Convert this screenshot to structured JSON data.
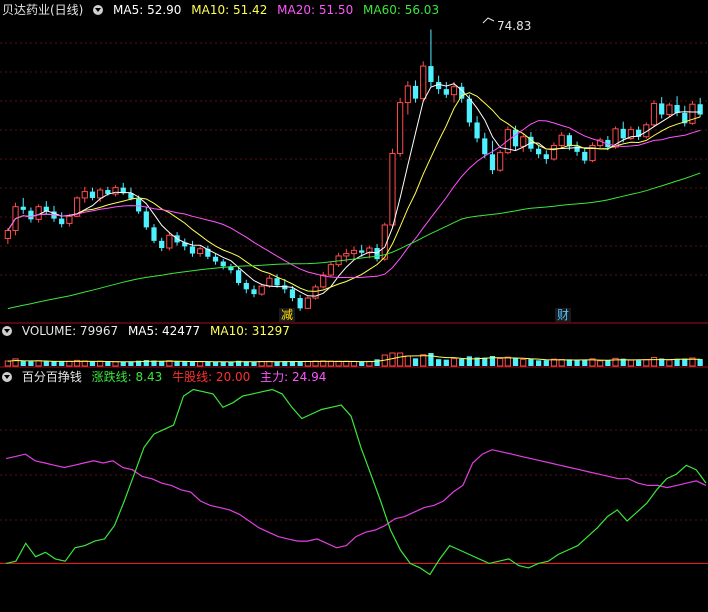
{
  "colors": {
    "bg": "#000000",
    "grid": "#5a0f0f",
    "divider": "#a0101a",
    "up": "#ff4d4d",
    "down": "#4ff0ff",
    "ma5": "#ffffff",
    "ma10": "#ffff55",
    "ma20": "#ff55ff",
    "ma60": "#3ce63c",
    "green_line": "#3ce63c",
    "pink_line": "#e040e0",
    "red_level": "#ff2020"
  },
  "main": {
    "title": "贝达药业(日线)",
    "ma_labels": [
      {
        "text": "MA5: 52.90",
        "color": "#ffffff"
      },
      {
        "text": "MA10: 51.42",
        "color": "#ffff55"
      },
      {
        "text": "MA20: 51.50",
        "color": "#ff55ff"
      },
      {
        "text": "MA60: 56.03",
        "color": "#3ce63c"
      }
    ],
    "peak_label": "74.83",
    "event_markers": [
      "减",
      "财"
    ]
  },
  "volume": {
    "title": "VOLUME: 79967",
    "ma_labels": [
      {
        "text": "MA5: 42477",
        "color": "#ffffff"
      },
      {
        "text": "MA10: 31297",
        "color": "#ffff55"
      }
    ]
  },
  "indicator": {
    "title": "百分百挣钱",
    "labels": [
      {
        "text": "涨跌线: 8.43",
        "color": "#3ce63c"
      },
      {
        "text": "牛股线: 20.00",
        "color": "#ff3030"
      },
      {
        "text": "主力: 24.94",
        "color": "#ff55ff"
      }
    ]
  },
  "chart_data": [
    {
      "type": "candlestick",
      "price_range": [
        40,
        76
      ],
      "candles": [
        [
          48.5,
          49.8,
          47.8,
          49.5
        ],
        [
          49.5,
          53.0,
          48.9,
          52.5
        ],
        [
          52.5,
          53.6,
          51.6,
          52.1
        ],
        [
          52.0,
          52.4,
          50.5,
          50.9
        ],
        [
          50.9,
          52.8,
          50.5,
          52.5
        ],
        [
          52.5,
          53.2,
          51.5,
          51.9
        ],
        [
          51.9,
          52.6,
          50.6,
          51.0
        ],
        [
          51.0,
          51.8,
          49.9,
          50.3
        ],
        [
          50.4,
          51.6,
          50.0,
          51.3
        ],
        [
          51.3,
          53.8,
          51.2,
          53.6
        ],
        [
          53.6,
          55.0,
          53.0,
          54.4
        ],
        [
          54.4,
          54.9,
          53.3,
          53.6
        ],
        [
          53.6,
          54.9,
          53.1,
          54.6
        ],
        [
          54.6,
          55.0,
          53.9,
          54.1
        ],
        [
          54.1,
          55.2,
          53.8,
          54.9
        ],
        [
          54.9,
          55.5,
          54.0,
          54.2
        ],
        [
          54.2,
          54.9,
          53.3,
          53.5
        ],
        [
          53.5,
          53.9,
          51.6,
          51.9
        ],
        [
          51.9,
          52.5,
          49.6,
          49.9
        ],
        [
          49.9,
          50.3,
          47.9,
          48.2
        ],
        [
          48.2,
          48.6,
          46.9,
          47.3
        ],
        [
          47.3,
          49.3,
          47.0,
          48.9
        ],
        [
          48.9,
          49.3,
          47.6,
          48.0
        ],
        [
          48.0,
          48.5,
          47.0,
          47.5
        ],
        [
          47.5,
          48.2,
          46.2,
          46.6
        ],
        [
          46.6,
          47.5,
          46.2,
          47.2
        ],
        [
          47.2,
          47.6,
          45.9,
          46.2
        ],
        [
          46.2,
          46.6,
          45.2,
          45.6
        ],
        [
          45.6,
          45.9,
          44.6,
          45.0
        ],
        [
          45.0,
          45.3,
          44.1,
          44.5
        ],
        [
          44.5,
          44.8,
          42.6,
          42.9
        ],
        [
          42.9,
          43.3,
          41.6,
          42.1
        ],
        [
          42.1,
          42.6,
          41.1,
          41.5
        ],
        [
          41.5,
          42.8,
          41.3,
          42.5
        ],
        [
          42.5,
          43.9,
          42.3,
          43.5
        ],
        [
          43.5,
          44.0,
          42.3,
          42.6
        ],
        [
          42.6,
          43.4,
          41.6,
          42.1
        ],
        [
          42.1,
          42.5,
          40.6,
          41.0
        ],
        [
          41.0,
          41.4,
          39.4,
          39.7
        ],
        [
          39.7,
          41.2,
          39.6,
          41.0
        ],
        [
          41.0,
          42.7,
          40.8,
          42.4
        ],
        [
          42.4,
          44.3,
          42.2,
          43.9
        ],
        [
          43.9,
          45.5,
          43.7,
          45.2
        ],
        [
          45.2,
          46.7,
          44.9,
          46.3
        ],
        [
          46.3,
          47.2,
          45.5,
          46.6
        ],
        [
          46.6,
          47.5,
          45.9,
          47.0
        ],
        [
          47.0,
          47.7,
          46.2,
          46.7
        ],
        [
          46.7,
          47.6,
          46.0,
          47.3
        ],
        [
          47.3,
          47.8,
          45.6,
          45.9
        ],
        [
          45.9,
          50.5,
          45.7,
          50.2
        ],
        [
          50.2,
          59.8,
          49.9,
          59.2
        ],
        [
          59.2,
          66.2,
          58.8,
          65.6
        ],
        [
          65.6,
          68.3,
          64.1,
          67.7
        ],
        [
          67.7,
          68.4,
          65.6,
          66.1
        ],
        [
          66.1,
          70.8,
          65.8,
          70.2
        ],
        [
          70.2,
          74.8,
          67.6,
          68.2
        ],
        [
          68.2,
          69.0,
          66.7,
          67.3
        ],
        [
          67.3,
          68.2,
          66.2,
          66.6
        ],
        [
          66.6,
          68.2,
          65.6,
          67.6
        ],
        [
          67.6,
          68.1,
          65.6,
          66.1
        ],
        [
          66.1,
          66.6,
          62.6,
          63.1
        ],
        [
          63.1,
          63.9,
          60.6,
          61.1
        ],
        [
          61.1,
          61.8,
          58.6,
          59.1
        ],
        [
          59.1,
          60.8,
          56.6,
          57.1
        ],
        [
          57.1,
          59.6,
          56.9,
          59.3
        ],
        [
          59.3,
          62.6,
          59.1,
          62.2
        ],
        [
          62.2,
          62.7,
          59.6,
          60.1
        ],
        [
          60.1,
          61.6,
          59.4,
          61.3
        ],
        [
          61.3,
          61.9,
          59.4,
          59.8
        ],
        [
          59.8,
          60.2,
          58.6,
          59.1
        ],
        [
          59.1,
          59.6,
          57.9,
          58.5
        ],
        [
          58.5,
          60.6,
          58.3,
          60.2
        ],
        [
          60.2,
          61.9,
          59.8,
          61.5
        ],
        [
          61.5,
          61.8,
          59.6,
          60.1
        ],
        [
          60.1,
          60.7,
          58.9,
          59.4
        ],
        [
          59.4,
          59.8,
          57.9,
          58.3
        ],
        [
          58.3,
          60.6,
          58.1,
          60.2
        ],
        [
          60.2,
          61.2,
          59.9,
          60.9
        ],
        [
          60.9,
          61.4,
          59.6,
          60.0
        ],
        [
          60.0,
          62.6,
          59.8,
          62.3
        ],
        [
          62.3,
          63.2,
          60.6,
          61.1
        ],
        [
          61.1,
          62.6,
          60.9,
          62.2
        ],
        [
          62.2,
          62.6,
          60.9,
          61.3
        ],
        [
          61.3,
          63.1,
          61.1,
          62.8
        ],
        [
          62.8,
          65.9,
          62.6,
          65.5
        ],
        [
          65.5,
          66.3,
          63.6,
          64.1
        ],
        [
          64.1,
          65.6,
          63.8,
          65.3
        ],
        [
          65.3,
          66.4,
          63.9,
          64.3
        ],
        [
          64.3,
          65.2,
          62.6,
          63.0
        ],
        [
          63.0,
          65.8,
          62.8,
          65.4
        ],
        [
          65.4,
          66.2,
          63.8,
          64.1
        ]
      ]
    },
    {
      "type": "line",
      "series_names": [
        "涨跌线",
        "主力"
      ],
      "y_range": [
        0,
        100
      ],
      "level": 20,
      "green": [
        20,
        21,
        29,
        23,
        25,
        22,
        21,
        27,
        28,
        30,
        31,
        37,
        48,
        60,
        72,
        78,
        80,
        82,
        95,
        98,
        97,
        96,
        90,
        92,
        95,
        96,
        97,
        98,
        96,
        90,
        85,
        87,
        89,
        90,
        91,
        86,
        72,
        60,
        48,
        35,
        26,
        20,
        18,
        15,
        22,
        28,
        26,
        24,
        22,
        20,
        21,
        22,
        19,
        18,
        20,
        21,
        24,
        26,
        28,
        32,
        36,
        41,
        44,
        39,
        43,
        47,
        53,
        58,
        60,
        64,
        62,
        56
      ],
      "pink": [
        67,
        68,
        69,
        66,
        65,
        64,
        63,
        64,
        65,
        66,
        65,
        66,
        63,
        62,
        59,
        58,
        56,
        55,
        53,
        52,
        48,
        46,
        45,
        44,
        42,
        39,
        36,
        34,
        32,
        31,
        30,
        30,
        31,
        29,
        27,
        28,
        32,
        34,
        35,
        37,
        40,
        41,
        43,
        45,
        46,
        48,
        52,
        55,
        65,
        69,
        71,
        70,
        69,
        68,
        67,
        66,
        65,
        64,
        63,
        62,
        61,
        60,
        59,
        58,
        58,
        56,
        55,
        55,
        54,
        55,
        56,
        57,
        55
      ]
    }
  ]
}
